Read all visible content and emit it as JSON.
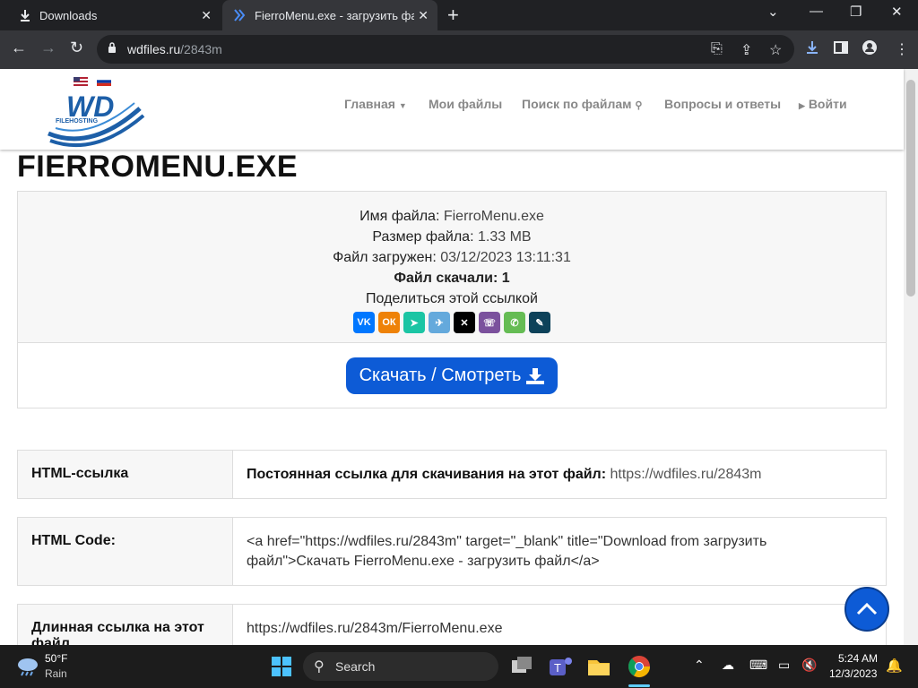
{
  "browser": {
    "tabs": [
      {
        "title": "Downloads"
      },
      {
        "title": "FierroMenu.exe - загрузить файл"
      }
    ],
    "url_host": "wdfiles.ru",
    "url_path": "/2843m"
  },
  "site": {
    "logo_text": "WD",
    "logo_subtext": "FILEHOSTING",
    "nav": [
      {
        "label": "Главная",
        "icon": "caret-down-icon"
      },
      {
        "label": "Мои файлы"
      },
      {
        "label": "Поиск по файлам",
        "icon": "search-icon"
      },
      {
        "label": "Вопросы и ответы"
      },
      {
        "label": "Войти",
        "icon": "caret-right-icon"
      }
    ]
  },
  "file": {
    "title": "FIERROMENU.EXE",
    "name_label": "Имя файла:",
    "name_value": "FierroMenu.exe",
    "size_label": "Размер файла:",
    "size_value": "1.33 MB",
    "uploaded_label": "Файл загружен:",
    "uploaded_value": "03/12/2023 13:11:31",
    "downloads_label": "Файл скачали:",
    "downloads_value": "1",
    "share_label": "Поделиться этой ссылкой",
    "share_icons": [
      "vk-icon",
      "odnoklassniki-icon",
      "moimir-icon",
      "telegram-icon",
      "x-icon",
      "viber-icon",
      "whatsapp-icon",
      "livejournal-icon"
    ],
    "download_button": "Скачать / Смотреть"
  },
  "details": [
    {
      "key": "HTML-ссылка",
      "bold_text": "Постоянная ссылка для скачивания на этот файл:",
      "value": "https://wdfiles.ru/2843m"
    },
    {
      "key": "HTML Code:",
      "value": "<a href=\"https://wdfiles.ru/2843m\" target=\"_blank\" title=\"Download from загрузить файл\">Скачать FierroMenu.exe - загрузить файл</a>"
    },
    {
      "key": "Длинная ссылка на этот файл",
      "value": "https://wdfiles.ru/2843m/FierroMenu.exe"
    }
  ],
  "taskbar": {
    "weather_temp": "50°F",
    "weather_desc": "Rain",
    "search_label": "Search",
    "time": "5:24 AM",
    "date": "12/3/2023"
  },
  "colors": {
    "accent": "#0d5bd6",
    "chrome_dark": "#202124",
    "chrome_toolbar": "#35363a"
  }
}
